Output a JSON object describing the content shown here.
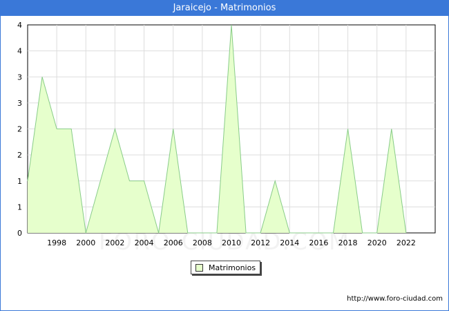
{
  "window": {
    "title": "Jaraicejo - Matrimonios"
  },
  "footer": {
    "source_url": "http://www.foro-ciudad.com",
    "watermark": "FORO-CIUDAD.COM"
  },
  "legend": {
    "label": "Matrimonios"
  },
  "colors": {
    "title_bar": "#3a78d8",
    "area_fill": "#e6ffcc",
    "line": "#88cc88",
    "grid": "#dddddd"
  },
  "chart_data": {
    "type": "area",
    "title": "Jaraicejo - Matrimonios",
    "xlabel": "",
    "ylabel": "",
    "x": [
      1996,
      1997,
      1998,
      1999,
      2000,
      2001,
      2002,
      2003,
      2004,
      2005,
      2006,
      2007,
      2008,
      2009,
      2010,
      2011,
      2012,
      2013,
      2014,
      2015,
      2016,
      2017,
      2018,
      2019,
      2020,
      2021,
      2022
    ],
    "series": [
      {
        "name": "Matrimonios",
        "values": [
          1,
          3,
          2,
          2,
          0,
          1,
          2,
          1,
          1,
          0,
          2,
          0,
          0,
          0,
          4,
          0,
          0,
          1,
          0,
          0,
          0,
          0,
          2,
          0,
          0,
          2,
          0
        ]
      }
    ],
    "xlim": [
      1996,
      2024
    ],
    "ylim": [
      0,
      4
    ],
    "x_tick_labels": [
      "1998",
      "2000",
      "2002",
      "2004",
      "2006",
      "2008",
      "2010",
      "2012",
      "2014",
      "2016",
      "2018",
      "2020",
      "2022"
    ],
    "y_tick_labels": [
      "0",
      "1",
      "1",
      "2",
      "2",
      "3",
      "3",
      "4",
      "4"
    ],
    "grid": true,
    "legend_position": "bottom"
  }
}
